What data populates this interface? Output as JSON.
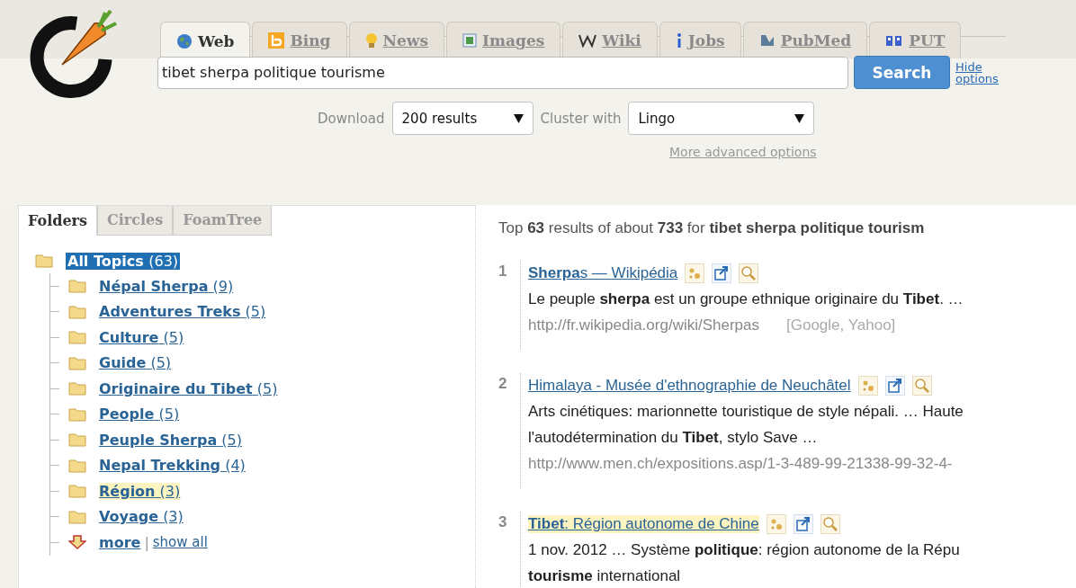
{
  "tabs": [
    {
      "label": "Web",
      "selected": true
    },
    {
      "label": "Bing",
      "selected": false
    },
    {
      "label": "News",
      "selected": false
    },
    {
      "label": "Images",
      "selected": false
    },
    {
      "label": "Wiki",
      "selected": false
    },
    {
      "label": "Jobs",
      "selected": false
    },
    {
      "label": "PubMed",
      "selected": false
    },
    {
      "label": "PUT",
      "selected": false
    }
  ],
  "search": {
    "value": "tibet sherpa politique tourisme",
    "button": "Search",
    "hide_options": "Hide options"
  },
  "options": {
    "download_label": "Download",
    "download_value": "200 results",
    "cluster_label": "Cluster with",
    "cluster_value": "Lingo",
    "advanced": "More advanced options"
  },
  "view_tabs": [
    {
      "label": "Folders",
      "selected": true
    },
    {
      "label": "Circles",
      "selected": false
    },
    {
      "label": "FoamTree",
      "selected": false
    }
  ],
  "tree": {
    "label": "All Topics",
    "count": "(63)",
    "selected": true,
    "children": [
      {
        "label": "Népal Sherpa",
        "count": "(9)",
        "highlighted": false
      },
      {
        "label": "Adventures Treks",
        "count": "(5)",
        "highlighted": false
      },
      {
        "label": "Culture",
        "count": "(5)",
        "highlighted": false
      },
      {
        "label": "Guide",
        "count": "(5)",
        "highlighted": false
      },
      {
        "label": "Originaire du Tibet",
        "count": "(5)",
        "highlighted": false
      },
      {
        "label": "People",
        "count": "(5)",
        "highlighted": false
      },
      {
        "label": "Peuple Sherpa",
        "count": "(5)",
        "highlighted": false
      },
      {
        "label": "Nepal Trekking",
        "count": "(4)",
        "highlighted": false
      },
      {
        "label": "Région",
        "count": "(3)",
        "highlighted": true
      },
      {
        "label": "Voyage",
        "count": "(3)",
        "highlighted": false
      }
    ],
    "more": "more",
    "separator": "|",
    "show_all": "show all"
  },
  "summary": "Top **63** results of about **733** for **tibet sherpa politique tourism**",
  "results": [
    {
      "number": "1",
      "title": "**Sherpa**s — Wikipédia",
      "highlighted": false,
      "snippet": [
        "Le peuple **sherpa** est un groupe ethnique originaire du **Tibet**. …"
      ],
      "url": "http://fr.wikipedia.org/wiki/Sherpas",
      "sources": "[Google, Yahoo]"
    },
    {
      "number": "2",
      "title": "Himalaya - Musée d'ethnographie de Neuchâtel",
      "highlighted": false,
      "snippet": [
        "Arts cinétiques: marionnette touristique de style népali. … Haute",
        "l'autodétermination du **Tibet**, stylo Save …"
      ],
      "url": "http://www.men.ch/expositions.asp/1-3-489-99-21338-99-32-4-"
    },
    {
      "number": "3",
      "title": "**Tibet**: Région autonome de Chine",
      "highlighted": true,
      "snippet": [
        "1 nov. 2012 … Système **politique**: région autonome de la Répu",
        "**tourisme** international"
      ]
    }
  ]
}
